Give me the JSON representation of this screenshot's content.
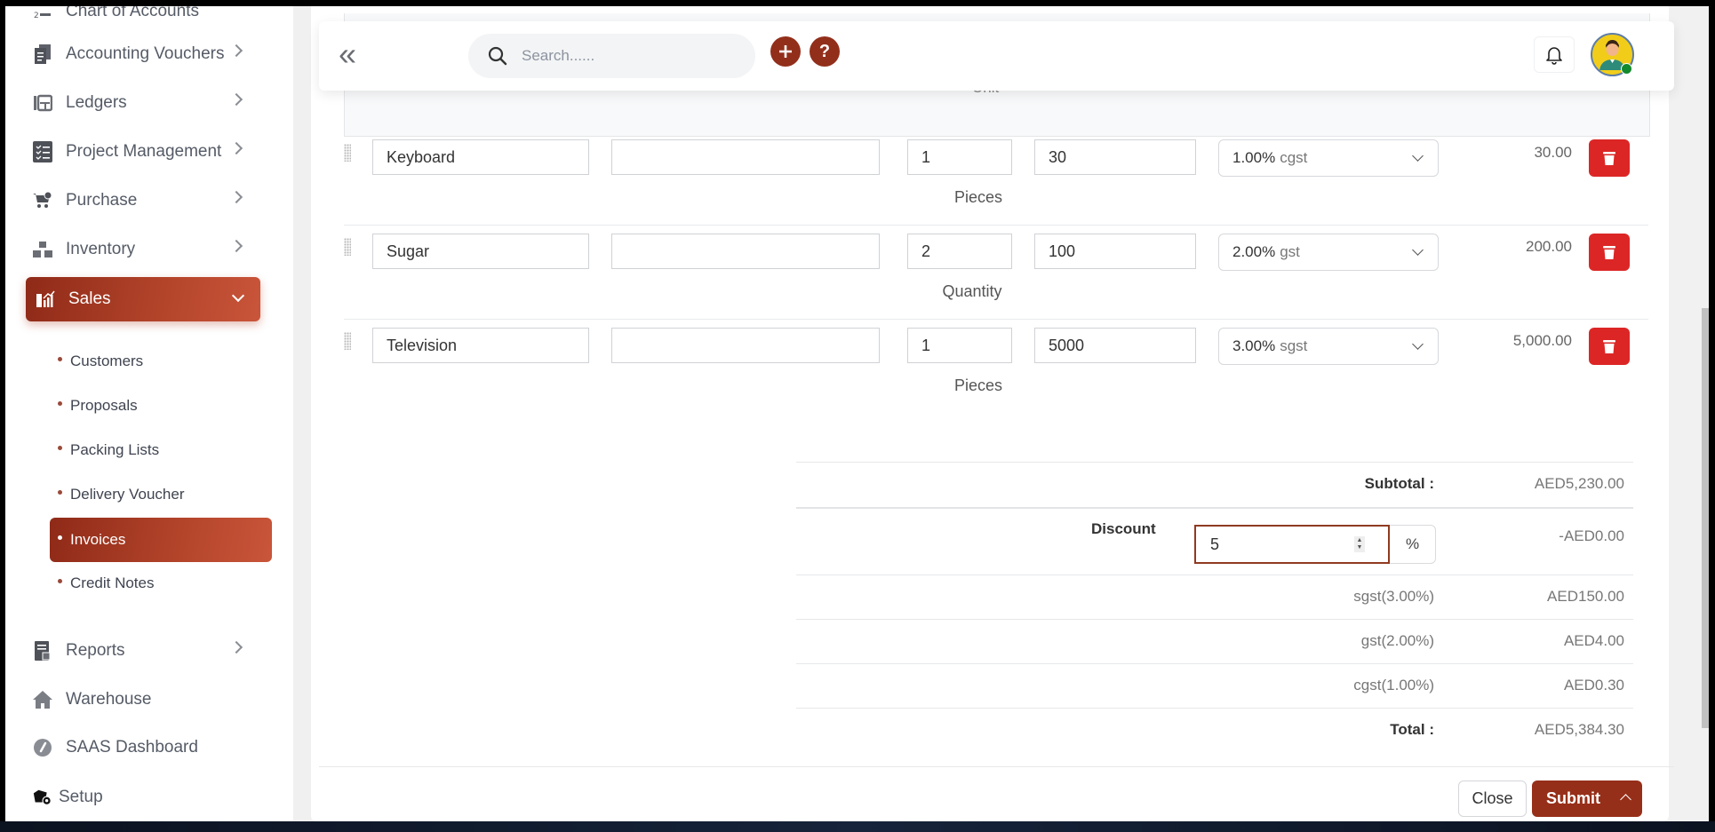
{
  "sidebar": {
    "items": [
      {
        "label": "Chart of Accounts",
        "icon": "list-numbered-icon"
      },
      {
        "label": "Accounting Vouchers",
        "icon": "vouchers-icon",
        "has_submenu": true
      },
      {
        "label": "Ledgers",
        "icon": "ledger-icon",
        "has_submenu": true
      },
      {
        "label": "Project Management",
        "icon": "checklist-icon",
        "has_submenu": true
      },
      {
        "label": "Purchase",
        "icon": "cart-icon",
        "has_submenu": true
      },
      {
        "label": "Inventory",
        "icon": "boxes-icon",
        "has_submenu": true
      },
      {
        "label": "Sales",
        "icon": "sales-chart-icon",
        "expanded": true,
        "active": true
      }
    ],
    "sales_submenu": [
      {
        "label": "Customers"
      },
      {
        "label": "Proposals"
      },
      {
        "label": "Packing Lists"
      },
      {
        "label": "Delivery Voucher"
      },
      {
        "label": "Invoices",
        "active": true
      },
      {
        "label": "Credit Notes"
      }
    ],
    "bottom_items": [
      {
        "label": "Reports",
        "icon": "report-icon",
        "has_submenu": true
      },
      {
        "label": "Warehouse",
        "icon": "home-icon"
      },
      {
        "label": "SAAS Dashboard",
        "icon": "dashboard-gauge-icon"
      },
      {
        "label": "Setup",
        "icon": "setup-gear-icon"
      }
    ]
  },
  "topbar": {
    "search_placeholder": "Search......",
    "add_label": "+",
    "help_label": "?"
  },
  "table": {
    "unit_header": "Unit",
    "rows": [
      {
        "item": "Keyboard",
        "description": "",
        "qty": "1",
        "rate": "30",
        "tax_rate": "1.00%",
        "tax_name": "cgst",
        "amount": "30.00",
        "unit": "Pieces"
      },
      {
        "item": "Sugar",
        "description": "",
        "qty": "2",
        "rate": "100",
        "tax_rate": "2.00%",
        "tax_name": "gst",
        "amount": "200.00",
        "unit": "Quantity"
      },
      {
        "item": "Television",
        "description": "",
        "qty": "1",
        "rate": "5000",
        "tax_rate": "3.00%",
        "tax_name": "sgst",
        "amount": "5,000.00",
        "unit": "Pieces"
      }
    ]
  },
  "totals": {
    "subtotal_label": "Subtotal :",
    "subtotal_value": "AED5,230.00",
    "discount_label": "Discount",
    "discount_value": "5",
    "discount_type": "%",
    "discount_amount": "-AED0.00",
    "taxes": [
      {
        "label": "sgst(3.00%)",
        "value": "AED150.00"
      },
      {
        "label": "gst(2.00%)",
        "value": "AED4.00"
      },
      {
        "label": "cgst(1.00%)",
        "value": "AED0.30"
      }
    ],
    "total_label": "Total :",
    "total_value": "AED5,384.30"
  },
  "footer": {
    "close_label": "Close",
    "submit_label": "Submit"
  },
  "colors": {
    "accent": "#962f19",
    "delete": "#dc2626",
    "online": "#138a2d"
  }
}
